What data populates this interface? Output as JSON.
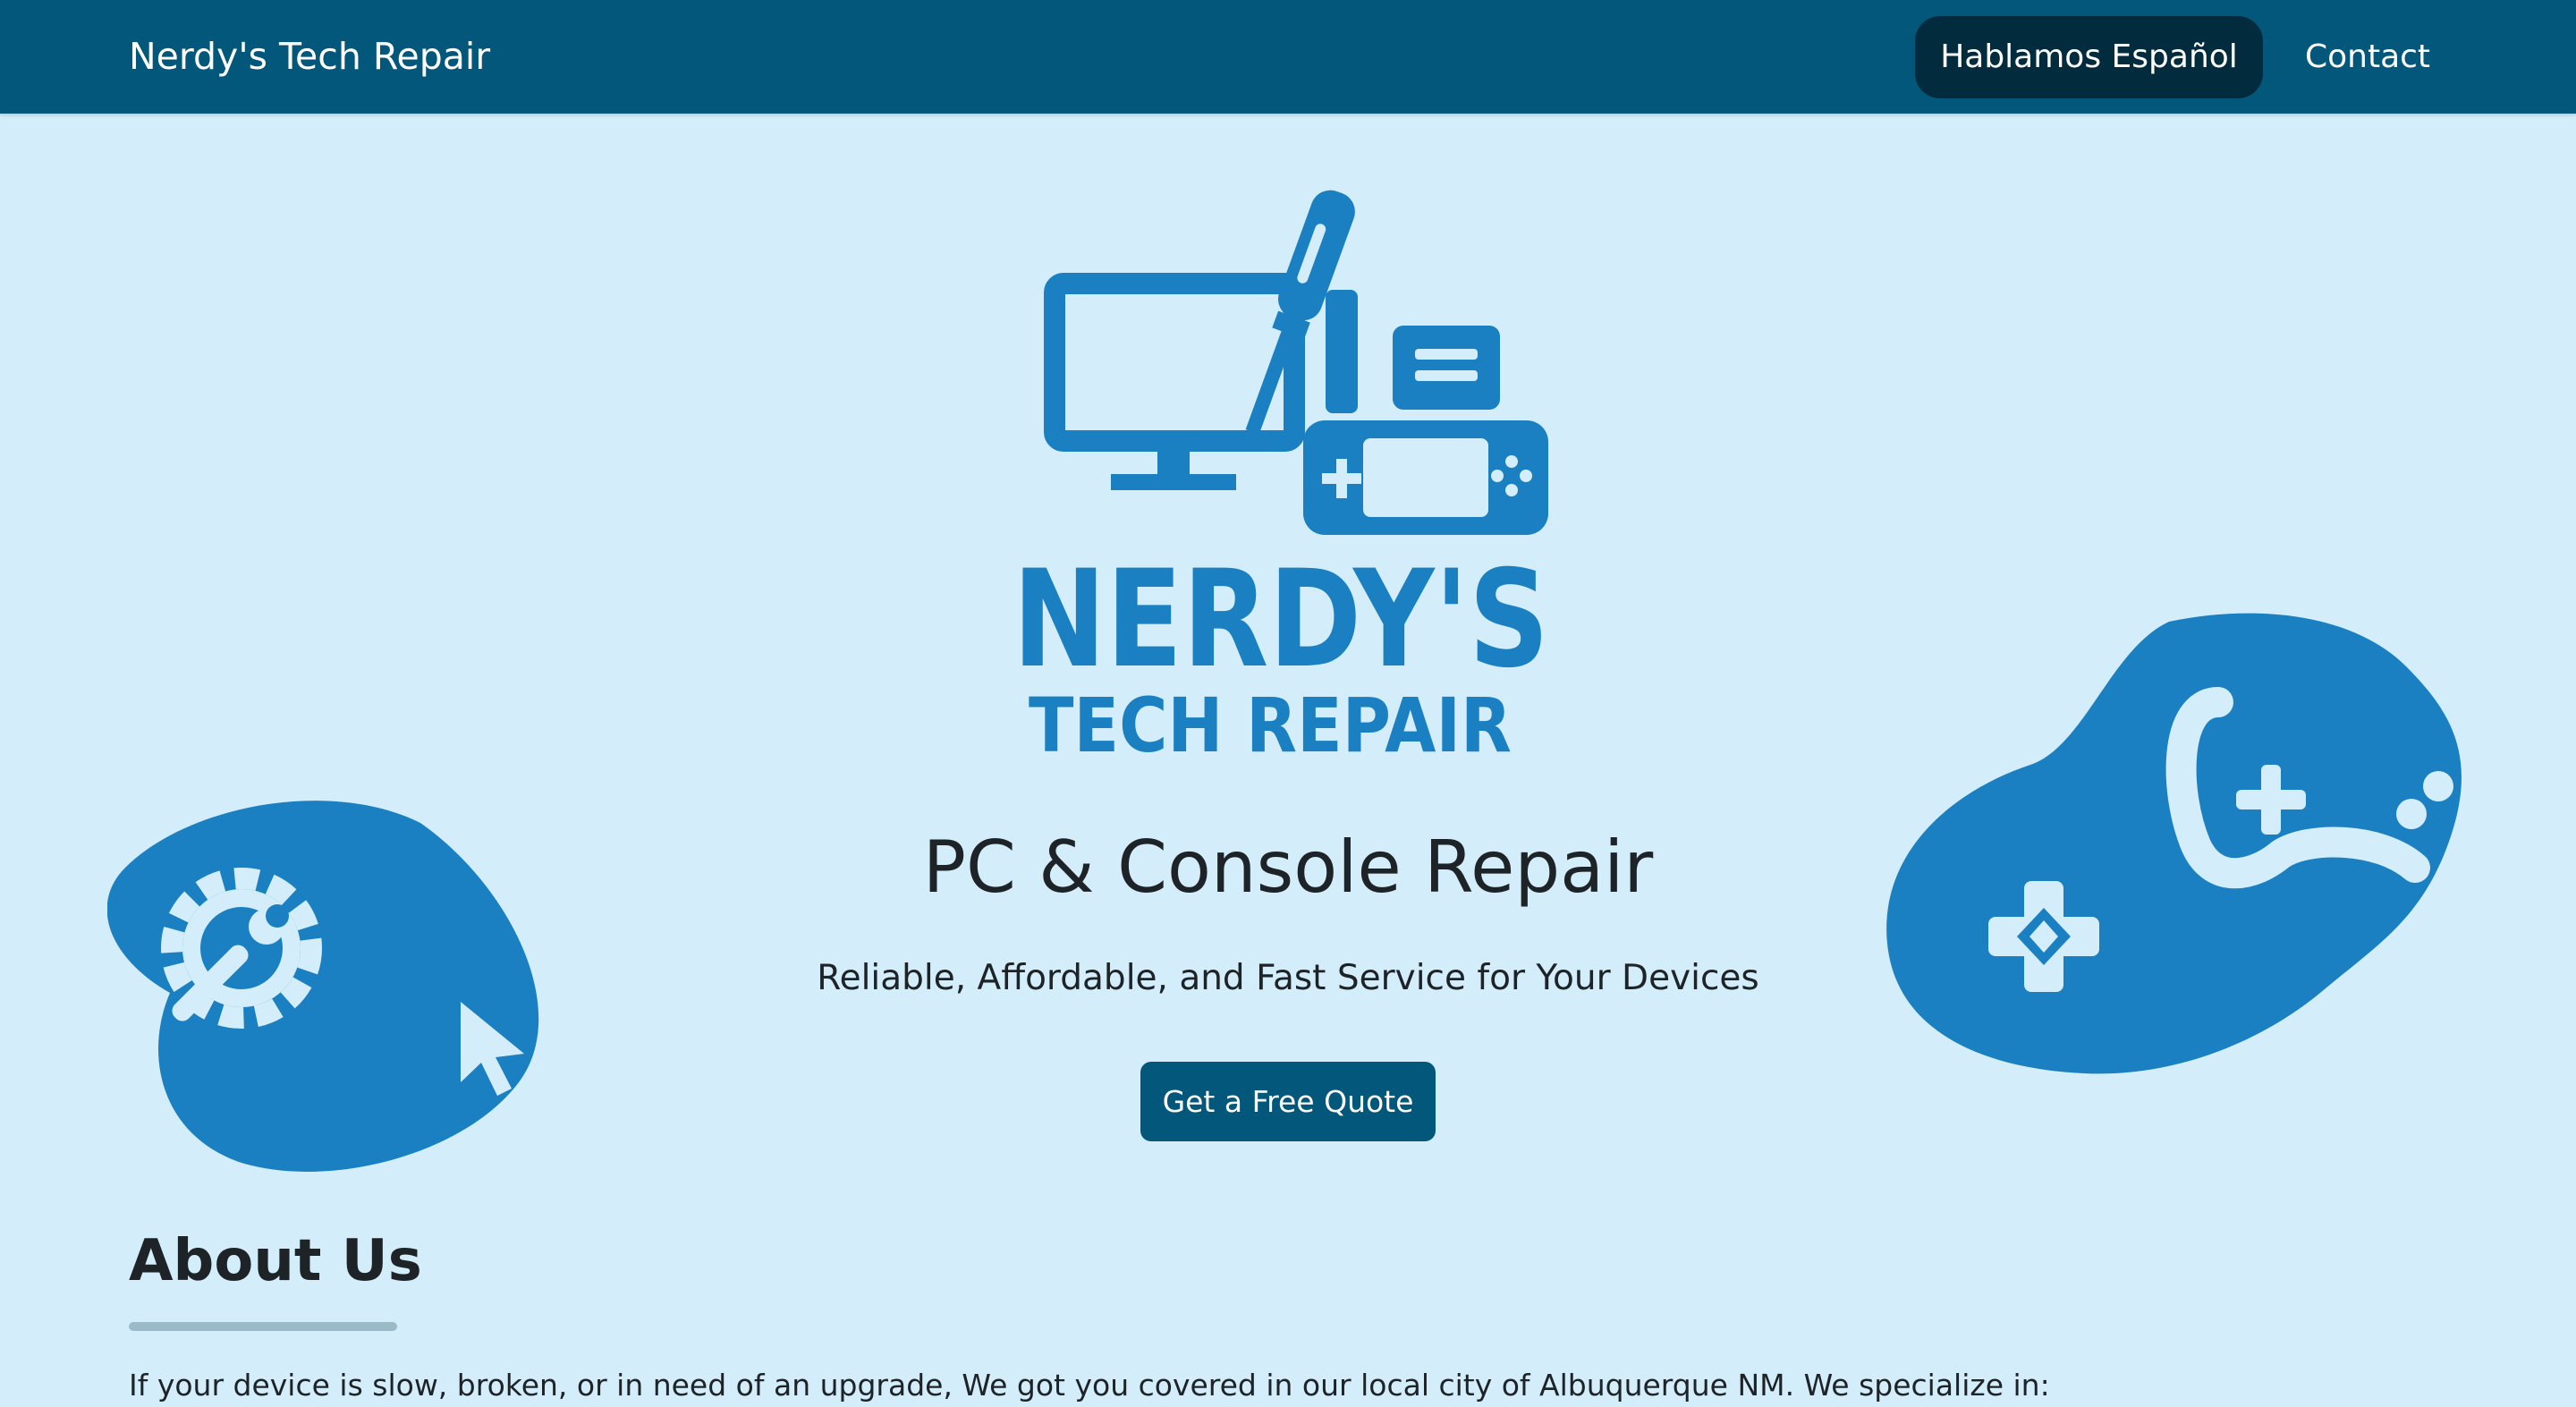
{
  "navbar": {
    "brand": "Nerdy's Tech Repair",
    "spanish_label": "Hablamos Español",
    "contact_label": "Contact",
    "bg_color": "#02577b",
    "pill_color": "#022c3d"
  },
  "logo": {
    "line1": "NERDY'S",
    "line2": "TECH REPAIR",
    "color": "#1b80c2"
  },
  "hero": {
    "title": "PC & Console Repair",
    "subtitle": "Reliable, Affordable, and Fast Service for Your Devices",
    "cta_label": "Get a Free Quote",
    "bg_color": "#d3eefa",
    "accent_color": "#1b80c2"
  },
  "decorations": {
    "left_icon": "gear-wrench-icon",
    "right_icon": "gamepad-icon"
  },
  "about": {
    "title": "About Us",
    "text": "If your device is slow, broken, or in need of an upgrade, We got you covered in our local city of Albuquerque NM. We specialize in:"
  }
}
